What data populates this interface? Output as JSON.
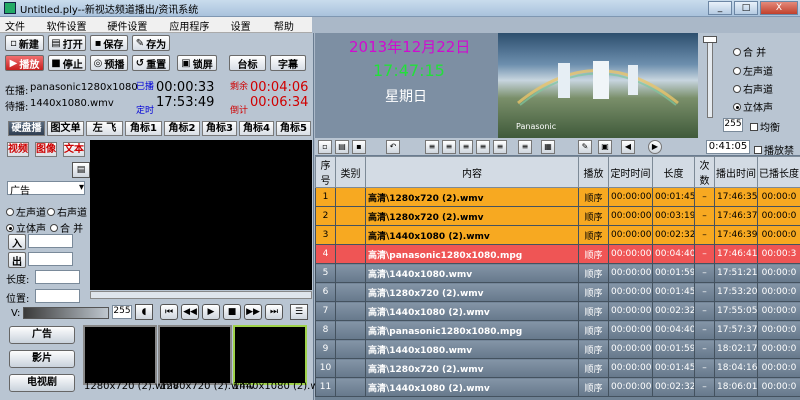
{
  "window": {
    "title": "Untitled.ply--新视达频道播出/资讯系统",
    "min": "_",
    "max": "□",
    "close": "X"
  },
  "menu": [
    "文件(F)",
    "软件设置(S)",
    "硬件设置(H)",
    "应用程序(Z)",
    "设置(N)",
    "帮助(H)"
  ],
  "toolbar": {
    "new": "新建",
    "open": "打开",
    "save": "保存",
    "saveas": "存为",
    "play": "播放",
    "stop": "停止",
    "preview": "预播",
    "reset": "重置",
    "lock": "锁屏",
    "logo": "台标",
    "subtitle": "字幕"
  },
  "status": {
    "playing_label": "在播:",
    "playing_file": "panasonic1280x1080",
    "waiting_label": "待播:",
    "waiting_file": "1440x1080.wmv",
    "played_label": "已播",
    "played_time": "00:00:33",
    "remain_label": "剩余",
    "remain_time": "00:04:06",
    "timed_label": "定时",
    "timed_time": "17:53:49",
    "countdown_label": "倒计",
    "countdown_time": "00:06:34"
  },
  "tabs": [
    "硬盘播",
    "图文单",
    "左 飞",
    "角标1",
    "角标2",
    "角标3",
    "角标4",
    "角标5"
  ],
  "media_tabs": [
    "视频",
    "图像",
    "文本"
  ],
  "category": {
    "value": "广告"
  },
  "audio": {
    "left": "左声道",
    "right": "右声道",
    "stereo": "立体声",
    "mix": "合 并"
  },
  "fields": {
    "in": "入",
    "out": "出",
    "length": "长度:",
    "position": "位置:"
  },
  "volume": {
    "label": "V:",
    "value": "255"
  },
  "side_buttons": [
    "广告",
    "影片",
    "电视剧"
  ],
  "thumbs": [
    "1280x720 (2).wmv",
    "1280x720 (2).wmv",
    "1440x1080 (2).wmv"
  ],
  "clock": {
    "date": "2013年12月22日",
    "time": "17:47:15",
    "weekday": "星期日"
  },
  "preview": {
    "brand": "Panasonic"
  },
  "output": {
    "mix": "合 并",
    "left": "左声道",
    "right": "右声道",
    "stereo": "立体声",
    "level": "255",
    "balance": "均衡"
  },
  "playlist_toolbar": {
    "time": "0:41:05",
    "prohibit": "播放禁"
  },
  "colors": {
    "played": "#f7a921",
    "current": "#ef5555",
    "pending": "#6d7f91"
  },
  "playlist": {
    "columns": [
      "序号",
      "类别",
      "内容",
      "播放",
      "定时时间",
      "长度",
      "次数",
      "播出时间",
      "已播长度"
    ],
    "rows": [
      {
        "no": "1",
        "cat": "",
        "content": "高清\\1280x720 (2).wmv",
        "mode": "顺序",
        "timed": "00:00:00",
        "len": "00:01:45",
        "cnt": "–",
        "air": "17:46:35",
        "played": "00:00:0",
        "st": "done"
      },
      {
        "no": "2",
        "cat": "",
        "content": "高清\\1280x720 (2).wmv",
        "mode": "顺序",
        "timed": "00:00:00",
        "len": "00:03:19",
        "cnt": "–",
        "air": "17:46:37",
        "played": "00:00:0",
        "st": "done"
      },
      {
        "no": "3",
        "cat": "",
        "content": "高清\\1440x1080 (2).wmv",
        "mode": "顺序",
        "timed": "00:00:00",
        "len": "00:02:32",
        "cnt": "–",
        "air": "17:46:39",
        "played": "00:00:0",
        "st": "done"
      },
      {
        "no": "4",
        "cat": "",
        "content": "高清\\panasonic1280x1080.mpg",
        "mode": "顺序",
        "timed": "00:00:00",
        "len": "00:04:40",
        "cnt": "–",
        "air": "17:46:41",
        "played": "00:00:3",
        "st": "cur"
      },
      {
        "no": "5",
        "cat": "",
        "content": "高清\\1440x1080.wmv",
        "mode": "顺序",
        "timed": "00:00:00",
        "len": "00:01:59",
        "cnt": "–",
        "air": "17:51:21",
        "played": "00:00:0",
        "st": "wait"
      },
      {
        "no": "6",
        "cat": "",
        "content": "高清\\1280x720 (2).wmv",
        "mode": "顺序",
        "timed": "00:00:00",
        "len": "00:01:45",
        "cnt": "–",
        "air": "17:53:20",
        "played": "00:00:0",
        "st": "wait"
      },
      {
        "no": "7",
        "cat": "",
        "content": "高清\\1440x1080 (2).wmv",
        "mode": "顺序",
        "timed": "00:00:00",
        "len": "00:02:32",
        "cnt": "–",
        "air": "17:55:05",
        "played": "00:00:0",
        "st": "wait"
      },
      {
        "no": "8",
        "cat": "",
        "content": "高清\\panasonic1280x1080.mpg",
        "mode": "顺序",
        "timed": "00:00:00",
        "len": "00:04:40",
        "cnt": "–",
        "air": "17:57:37",
        "played": "00:00:0",
        "st": "wait"
      },
      {
        "no": "9",
        "cat": "",
        "content": "高清\\1440x1080.wmv",
        "mode": "顺序",
        "timed": "00:00:00",
        "len": "00:01:59",
        "cnt": "–",
        "air": "18:02:17",
        "played": "00:00:0",
        "st": "wait"
      },
      {
        "no": "10",
        "cat": "",
        "content": "高清\\1280x720 (2).wmv",
        "mode": "顺序",
        "timed": "00:00:00",
        "len": "00:01:45",
        "cnt": "–",
        "air": "18:04:16",
        "played": "00:00:0",
        "st": "wait"
      },
      {
        "no": "11",
        "cat": "",
        "content": "高清\\1440x1080 (2).wmv",
        "mode": "顺序",
        "timed": "00:00:00",
        "len": "00:02:32",
        "cnt": "–",
        "air": "18:06:01",
        "played": "00:00:0",
        "st": "wait"
      }
    ]
  }
}
